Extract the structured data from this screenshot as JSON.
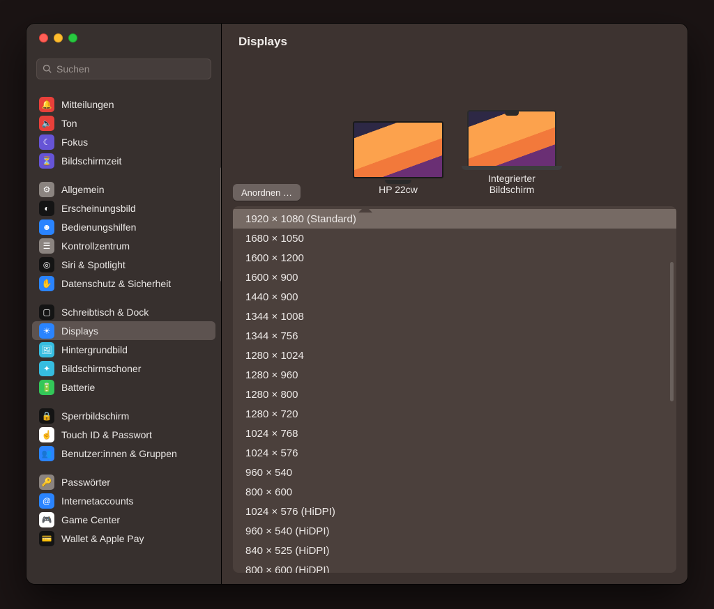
{
  "header": {
    "title": "Displays"
  },
  "search": {
    "placeholder": "Suchen"
  },
  "traffic": {
    "close": "close",
    "min": "minimize",
    "max": "zoom"
  },
  "sidebar": {
    "groups": [
      {
        "items": [
          {
            "label": "Mitteilungen",
            "icon": "bell",
            "bg": "#e8403a"
          },
          {
            "label": "Ton",
            "icon": "speaker",
            "bg": "#e8403a"
          },
          {
            "label": "Fokus",
            "icon": "moon",
            "bg": "#6654d6"
          },
          {
            "label": "Bildschirmzeit",
            "icon": "hourglass",
            "bg": "#6654d6"
          }
        ]
      },
      {
        "items": [
          {
            "label": "Allgemein",
            "icon": "gear",
            "bg": "#8b8480"
          },
          {
            "label": "Erscheinungsbild",
            "icon": "circle-half",
            "bg": "#141414"
          },
          {
            "label": "Bedienungshilfen",
            "icon": "person",
            "bg": "#2a84ff"
          },
          {
            "label": "Kontrollzentrum",
            "icon": "sliders",
            "bg": "#8b8480"
          },
          {
            "label": "Siri & Spotlight",
            "icon": "siri",
            "bg": "#141414"
          },
          {
            "label": "Datenschutz & Sicherheit",
            "icon": "hand",
            "bg": "#2a84ff"
          }
        ]
      },
      {
        "items": [
          {
            "label": "Schreibtisch & Dock",
            "icon": "dock",
            "bg": "#141414"
          },
          {
            "label": "Displays",
            "icon": "sun",
            "bg": "#2a84ff",
            "selected": true
          },
          {
            "label": "Hintergrundbild",
            "icon": "image",
            "bg": "#36bde0"
          },
          {
            "label": "Bildschirmschoner",
            "icon": "sparkle",
            "bg": "#36bde0"
          },
          {
            "label": "Batterie",
            "icon": "battery",
            "bg": "#33c759"
          }
        ]
      },
      {
        "items": [
          {
            "label": "Sperrbildschirm",
            "icon": "lock",
            "bg": "#141414"
          },
          {
            "label": "Touch ID & Passwort",
            "icon": "finger",
            "bg": "#ffffff"
          },
          {
            "label": "Benutzer:innen & Gruppen",
            "icon": "users",
            "bg": "#2a84ff"
          }
        ]
      },
      {
        "items": [
          {
            "label": "Passwörter",
            "icon": "key",
            "bg": "#8b8480"
          },
          {
            "label": "Internetaccounts",
            "icon": "at",
            "bg": "#2a84ff"
          },
          {
            "label": "Game Center",
            "icon": "game",
            "bg": "#ffffff"
          },
          {
            "label": "Wallet & Apple Pay",
            "icon": "wallet",
            "bg": "#141414"
          }
        ]
      }
    ]
  },
  "monitors": [
    {
      "label": "HP 22cw",
      "kind": "external"
    },
    {
      "label": "Integrierter Bildschirm",
      "kind": "builtin"
    }
  ],
  "arrange_button": "Anordnen …",
  "resolutions": {
    "selected_index": 0,
    "items": [
      "1920 × 1080 (Standard)",
      "1680 × 1050",
      "1600 × 1200",
      "1600 × 900",
      "1440 × 900",
      "1344 × 1008",
      "1344 × 756",
      "1280 × 1024",
      "1280 × 960",
      "1280 × 800",
      "1280 × 720",
      "1024 × 768",
      "1024 × 576",
      "960 × 540",
      "800 × 600",
      "1024 × 576 (HiDPI)",
      "960 × 540 (HiDPI)",
      "840 × 525 (HiDPI)",
      "800 × 600 (HiDPI)"
    ]
  },
  "colors": {
    "accent": "#2a84ff"
  },
  "icon_glyphs": {
    "bell": "🔔",
    "speaker": "🔈",
    "moon": "☾",
    "hourglass": "⏳",
    "gear": "⚙",
    "circle-half": "◐",
    "person": "☻",
    "sliders": "☰",
    "siri": "◎",
    "hand": "✋",
    "dock": "▢",
    "sun": "☀",
    "image": "🖼",
    "sparkle": "✦",
    "battery": "🔋",
    "lock": "🔒",
    "finger": "☝",
    "users": "👥",
    "key": "🔑",
    "at": "@",
    "game": "🎮",
    "wallet": "💳"
  }
}
